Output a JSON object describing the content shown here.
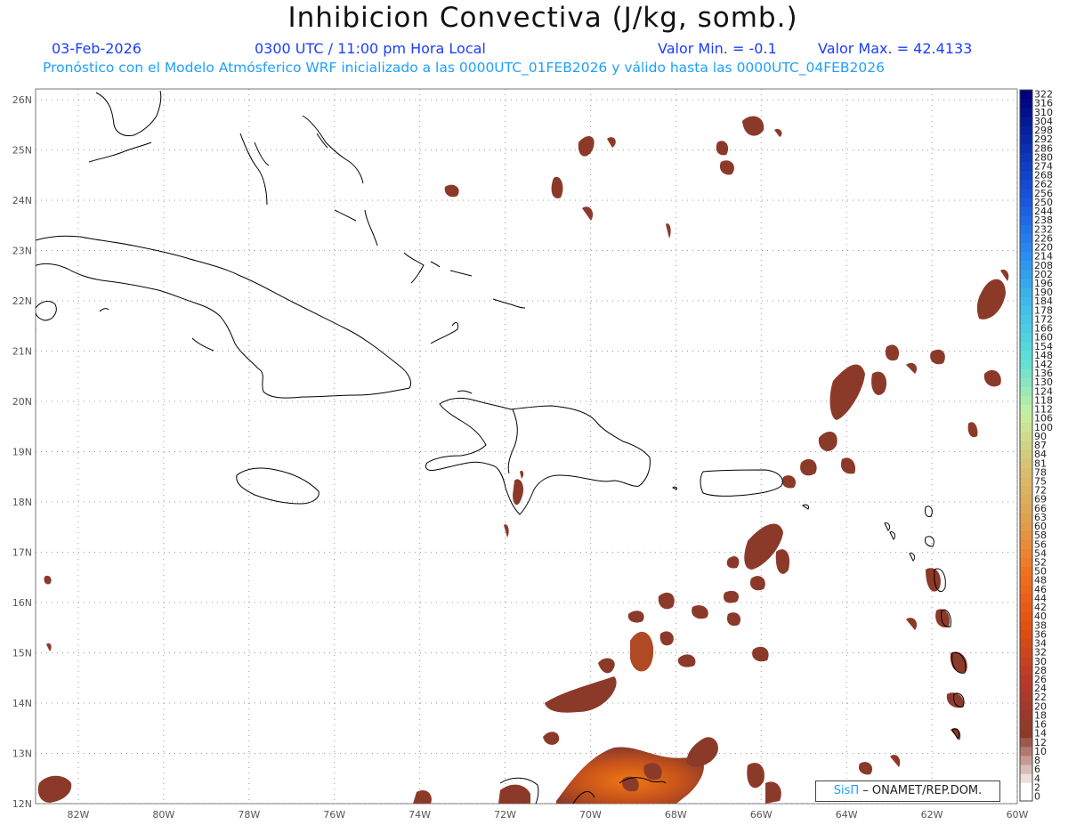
{
  "header": {
    "title": "Inhibicion Convectiva (J/kg, somb.)",
    "date": "03-Feb-2026",
    "time": "0300 UTC / 11:00 pm Hora Local",
    "value_min": "Valor Min. = -0.1",
    "value_max": "Valor Max. = 42.4133",
    "model_info": "Pronóstico con el Modelo Atmósferico WRF inicializado a las 0000UTC_01FEB2026 y válido hasta las  0000UTC_04FEB2026"
  },
  "map": {
    "lat_labels": [
      "26N",
      "25N",
      "24N",
      "23N",
      "22N",
      "21N",
      "20N",
      "19N",
      "18N",
      "17N",
      "16N",
      "15N",
      "14N",
      "13N",
      "12N"
    ],
    "lon_labels": [
      "82W",
      "80W",
      "78W",
      "76W",
      "74W",
      "72W",
      "70W",
      "68W",
      "66W",
      "64W",
      "62W",
      "60W"
    ],
    "lat_range": [
      12,
      26
    ],
    "lon_range": [
      -83,
      -60
    ],
    "coastline_color": "#000000",
    "grid_color": "#999999",
    "shade_colors": [
      "#8b3a2a",
      "#b8451f",
      "#e36a10"
    ]
  },
  "colorbar": {
    "labels": [
      "322",
      "316",
      "310",
      "304",
      "298",
      "292",
      "286",
      "280",
      "274",
      "268",
      "262",
      "256",
      "250",
      "244",
      "238",
      "232",
      "226",
      "220",
      "214",
      "208",
      "202",
      "196",
      "190",
      "184",
      "178",
      "172",
      "166",
      "160",
      "154",
      "148",
      "142",
      "136",
      "130",
      "124",
      "118",
      "112",
      "106",
      "100",
      "90",
      "87",
      "84",
      "81",
      "78",
      "75",
      "72",
      "69",
      "66",
      "63",
      "60",
      "58",
      "56",
      "54",
      "52",
      "50",
      "48",
      "46",
      "44",
      "42",
      "40",
      "38",
      "36",
      "34",
      "32",
      "30",
      "28",
      "26",
      "24",
      "22",
      "20",
      "18",
      "16",
      "14",
      "12",
      "10",
      "8",
      "6",
      "4",
      "2",
      "0"
    ],
    "colors_top_to_bottom": [
      "#00007a",
      "#0a2fb0",
      "#1a56e0",
      "#2a8cf0",
      "#40c0e8",
      "#5ee0d8",
      "#c8f0a0",
      "#d8c070",
      "#e0a050",
      "#f07020",
      "#e05010",
      "#b8382a",
      "#8b3a2a",
      "#ffffff"
    ]
  },
  "credit": {
    "brand": "SisΠ",
    "text": "– ONAMET/REP.DOM."
  }
}
